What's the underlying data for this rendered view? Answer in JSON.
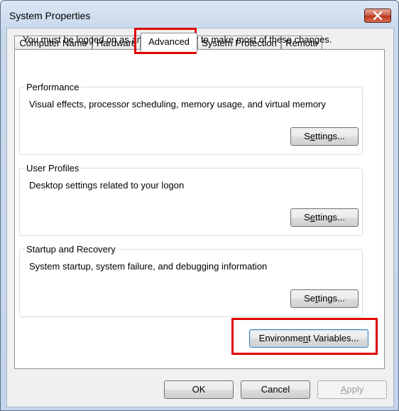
{
  "window": {
    "title": "System Properties"
  },
  "tabs": [
    {
      "label": "Computer Name"
    },
    {
      "label": "Hardware"
    },
    {
      "label": "Advanced"
    },
    {
      "label": "System Protection"
    },
    {
      "label": "Remote"
    }
  ],
  "active_tab": "Advanced",
  "intro": "You must be logged on as an Administrator to make most of these changes.",
  "groups": [
    {
      "label": "Performance",
      "description": "Visual effects, processor scheduling, memory usage, and virtual memory",
      "button": {
        "pre": "S",
        "accel": "e",
        "post": "ttings..."
      }
    },
    {
      "label": "User Profiles",
      "description": "Desktop settings related to your logon",
      "button": {
        "pre": "S",
        "accel": "e",
        "post": "ttings..."
      }
    },
    {
      "label": "Startup and Recovery",
      "description": "System startup, system failure, and debugging information",
      "button": {
        "pre": "Se",
        "accel": "t",
        "post": "tings..."
      }
    }
  ],
  "env_button": {
    "pre": "Environme",
    "accel": "n",
    "post": "t Variables..."
  },
  "footer": {
    "ok": "OK",
    "cancel": "Cancel",
    "apply_accel": "A",
    "apply_rest": "pply"
  },
  "highlight_color": "#e00000"
}
